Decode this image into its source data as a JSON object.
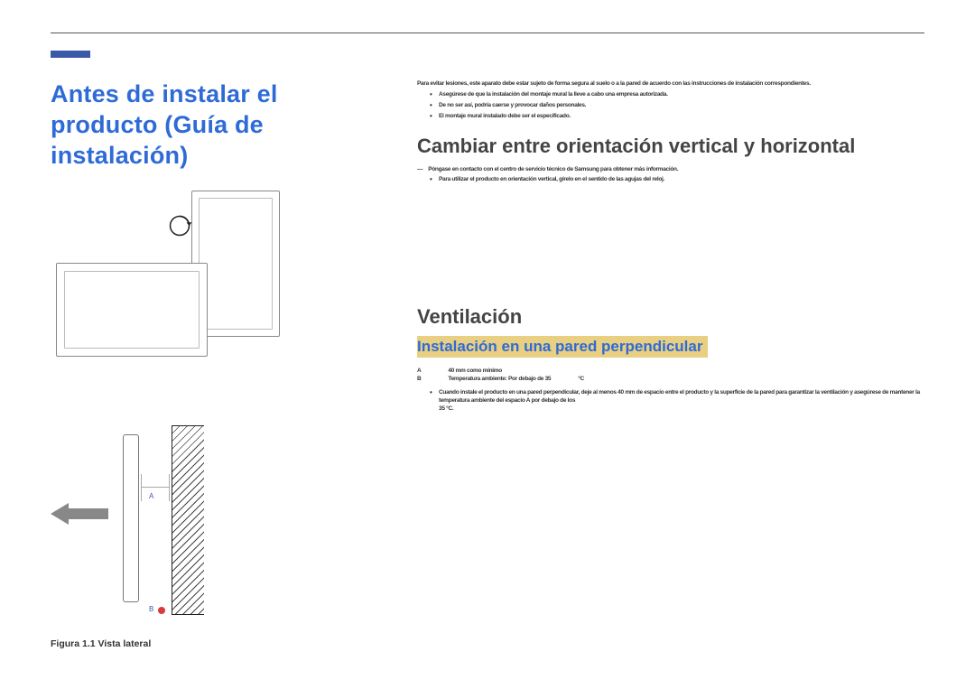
{
  "title": "Antes de instalar el producto (Guía de instalación)",
  "figure1": {
    "caption": "Figura 1.1 Vista lateral",
    "label_a": "A",
    "label_b": "B"
  },
  "warning": {
    "intro": "Para evitar lesiones, este aparato debe estar sujeto de forma segura al suelo o a la pared de acuerdo con las instrucciones de instalación correspondientes.",
    "items": [
      "Asegúrese de que la instalación del montaje mural la lleve a cabo una empresa autorizada.",
      "De no ser así, podría caerse y provocar daños personales.",
      "El montaje mural instalado debe ser el especificado."
    ]
  },
  "orientation": {
    "heading": "Cambiar entre orientación vertical y horizontal",
    "note_label": "―",
    "note": "Póngase en contacto con el centro de servicio técnico de Samsung para obtener más información.",
    "items": [
      "Para utilizar el producto en orientación vertical, gírelo en el sentido de las agujas del reloj."
    ]
  },
  "ventilation": {
    "heading": "Ventilación",
    "subheading": "Instalación en una pared perpendicular",
    "line_a_label": "A",
    "line_a_value": "40 mm como mínimo",
    "line_b_label": "B",
    "line_b_value": "Temperatura ambiente: Por debajo de 35",
    "degree": "°C",
    "bullet": "Cuando instale el producto en una pared perpendicular, deje al menos 40 mm de espacio entre el producto y la superficie de la pared para garantizar la ventilación y asegúrese de mantener la temperatura ambiente del espacio A por debajo de los",
    "bullet_tail": "35 °C."
  }
}
